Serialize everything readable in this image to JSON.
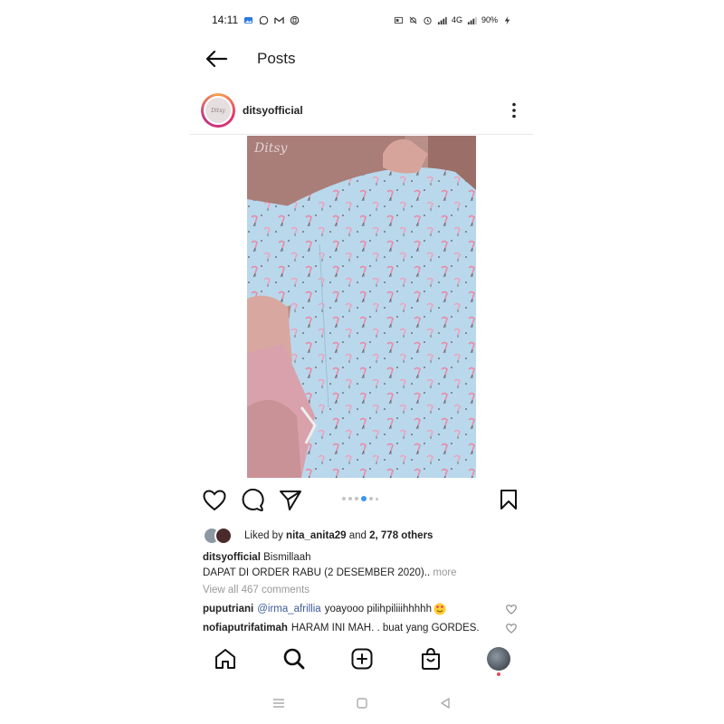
{
  "status_bar": {
    "time": "14:11",
    "battery": "90%",
    "network": "4G"
  },
  "header": {
    "title": "Posts",
    "back_icon": "arrow-left-icon"
  },
  "post": {
    "author": "ditsyofficial",
    "avatar_text": "Ditsy",
    "image_watermark": "Ditsy",
    "carousel": {
      "count": 6,
      "active_index": 3
    },
    "likes": {
      "prefix": "Liked by",
      "user": "nita_anita29",
      "middle": "and",
      "others": "2, 778 others"
    },
    "caption": {
      "user": "ditsyofficial",
      "first_line": "Bismillaah",
      "second_line": "DAPAT DI ORDER  RABU (2 DESEMBER 2020)..",
      "more_label": "more"
    },
    "view_comments_label": "View all 467 comments",
    "comments": [
      {
        "user": "puputriani",
        "mention": "@irma_afrillia",
        "text": "yoayooo pilihpiliiihhhhh"
      },
      {
        "user": "nofiaputrifatimah",
        "mention": "",
        "text": "HARAM INI MAH. .  buat yang GORDES."
      }
    ]
  },
  "colors": {
    "accent_blue": "#3897f0",
    "mention_blue": "#3b5998",
    "notification_red": "#ed4956",
    "fabric_blue": "#b8d6ea",
    "sleeve_mauve": "#a8807c"
  }
}
